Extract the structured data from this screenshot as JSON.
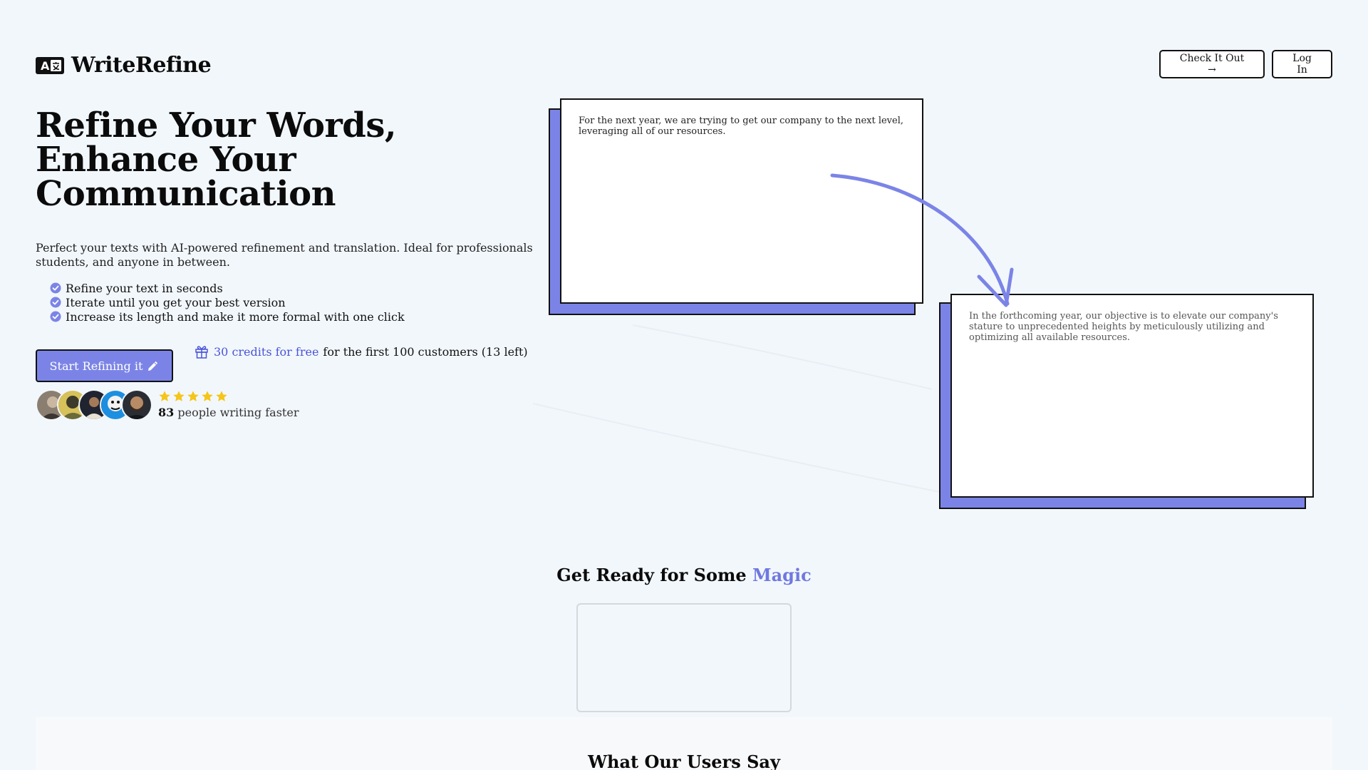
{
  "brand": {
    "name": "WriteRefine",
    "logo_icon": "translate-icon"
  },
  "nav": {
    "check_label": "Check It Out →",
    "login_label": "Log In"
  },
  "hero": {
    "title_lines": [
      "Refine Your Words,",
      "Enhance Your",
      "Communication"
    ],
    "subtitle": "Perfect your texts with AI-powered refinement and translation. Ideal for professionals, students, and anyone in between.",
    "features": [
      "Refine your text in seconds",
      "Iterate until you get your best version",
      "Increase its length and make it more formal with one click"
    ],
    "cta_label": "Start Refining it",
    "cta_icon": "pencil-icon",
    "promo": {
      "icon": "gift-icon",
      "highlight": "30 credits for free",
      "rest": "for the first 100 customers (13 left)"
    },
    "social_proof": {
      "avatar_count": 5,
      "stars": 5,
      "count": "83",
      "text": "people writing faster"
    }
  },
  "illustration": {
    "before_text": "For the next year, we are trying to get our company to the next level, leveraging all of our resources.",
    "after_text": "In the forthcoming year, our objective is to elevate our company's stature to unprecedented heights by meticulously utilizing and optimizing all available resources."
  },
  "magic_section": {
    "title_prefix": "Get Ready for Some ",
    "title_accent": "Magic"
  },
  "testimonials": {
    "title": "What Our Users Say"
  },
  "colors": {
    "accent": "#7b84e6",
    "accent_text": "#4a54d8",
    "background": "#f2f7fc",
    "star": "#f5c518"
  }
}
